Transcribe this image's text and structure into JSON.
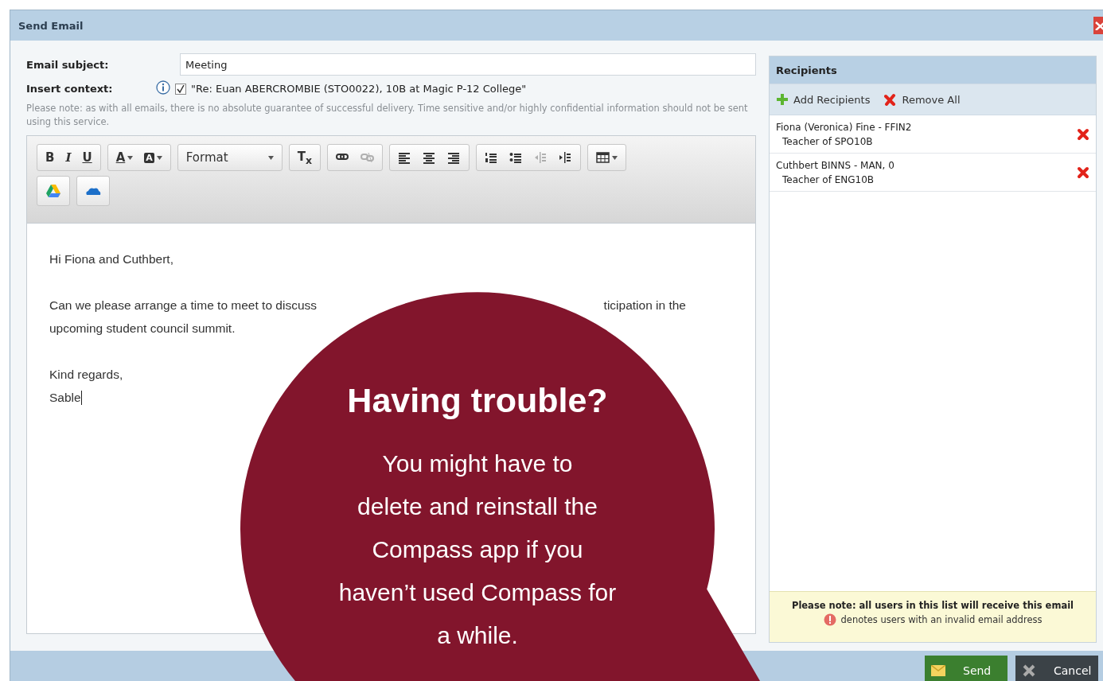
{
  "window": {
    "title": "Send Email"
  },
  "compose": {
    "subject_label": "Email subject:",
    "subject_value": "Meeting",
    "context_label": "Insert context:",
    "context_checked": true,
    "context_text": "\"Re: Euan ABERCROMBIE (STO0022), 10B at Magic P-12 College\"",
    "note": "Please note: as with all emails, there is no absolute guarantee of successful delivery. Time sensitive and/or highly confidential information should not be sent using this service.",
    "toolbar": [
      [
        {
          "kind": "bold",
          "label": "B",
          "disabled": false
        },
        {
          "kind": "italic",
          "label": "I",
          "disabled": false
        },
        {
          "kind": "underline",
          "label": "U",
          "disabled": false
        }
      ],
      [
        {
          "kind": "textcolor",
          "label": "A",
          "disabled": false
        },
        {
          "kind": "bgcolor",
          "label": "A",
          "disabled": false
        }
      ],
      [
        {
          "kind": "format",
          "label": "Format",
          "disabled": false
        }
      ],
      [
        {
          "kind": "removeformat",
          "label": "T$_{x}$",
          "disabled": false
        }
      ],
      [
        {
          "kind": "link",
          "disabled": false
        },
        {
          "kind": "unlink",
          "disabled": true
        }
      ],
      [
        {
          "kind": "alignleft",
          "disabled": false
        },
        {
          "kind": "aligncenter",
          "disabled": false
        },
        {
          "kind": "alignright",
          "disabled": false
        }
      ],
      [
        {
          "kind": "numlist",
          "disabled": false
        },
        {
          "kind": "bullist",
          "disabled": false
        },
        {
          "kind": "outdent",
          "disabled": true
        },
        {
          "kind": "indent",
          "disabled": false
        }
      ],
      [
        {
          "kind": "table",
          "disabled": false
        }
      ]
    ],
    "toolbar_row2": [
      {
        "kind": "triangle"
      },
      {
        "kind": "cloud"
      }
    ],
    "body": [
      [
        [
          "Hi Fiona and Cuthbert,"
        ]
      ],
      [
        [
          "Can we please arrange a time to meet to discuss",
          "ticipation in the"
        ],
        [
          "upcoming student council summit."
        ]
      ],
      [
        [
          "Kind regards,"
        ],
        [
          "Sable"
        ]
      ]
    ],
    "text_caret": true
  },
  "recipients": {
    "title": "Recipients",
    "actions": [
      {
        "kind": "add",
        "label": "Add Recipients"
      },
      {
        "kind": "remove",
        "label": "Remove All"
      }
    ],
    "items": [
      {
        "name": "Fiona (Veronica) Fine - FFIN2",
        "detail": "Teacher of SPO10B"
      },
      {
        "name": "Cuthbert BINNS - MAN, 0",
        "detail": "Teacher of ENG10B"
      }
    ],
    "note": "Please note: all users in this list will receive this email",
    "legend": "denotes users with an invalid email address"
  },
  "footer": {
    "buttons": [
      {
        "kind": "send",
        "label": "Send"
      },
      {
        "kind": "cancel",
        "label": "Cancel"
      }
    ]
  },
  "overlay": {
    "title": "Having trouble?",
    "lines": [
      "You might have to",
      "delete and reinstall the",
      "Compass app if you",
      "haven’t used Compass for",
      "a while."
    ]
  }
}
